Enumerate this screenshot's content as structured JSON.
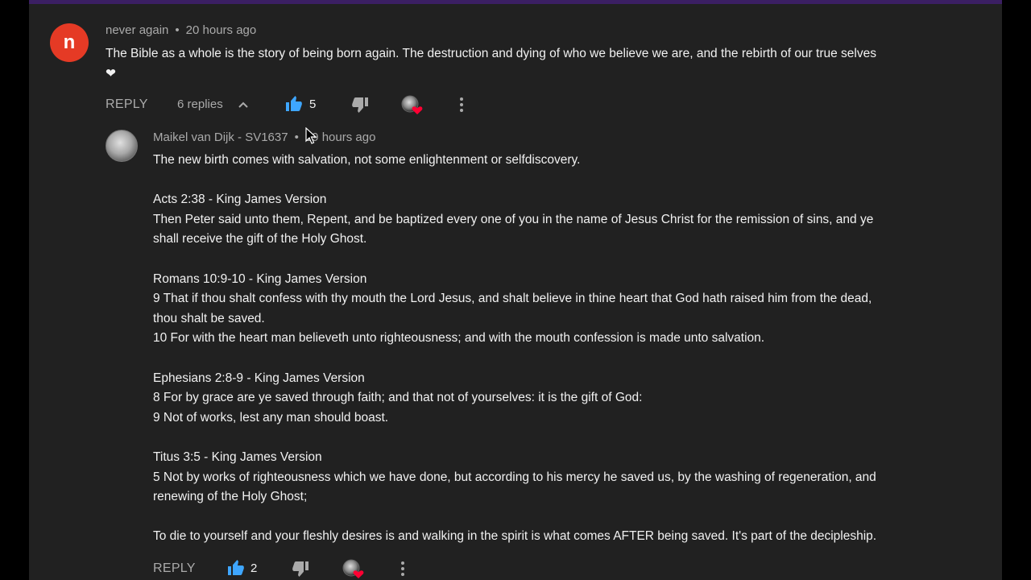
{
  "comment": {
    "avatar_letter": "n",
    "author": "never again",
    "separator": "•",
    "time": "20 hours ago",
    "text_line1": "The Bible as a whole is the story of being born again. The destruction and dying of who we believe we are, and the rebirth of our true selves",
    "text_line2": "❤",
    "reply_label": "REPLY",
    "replies_label": "6 replies",
    "likes": "5"
  },
  "reply": {
    "author": "Maikel van Dijk - SV1637",
    "separator": "•",
    "time": "19 hours ago",
    "lines": [
      "The new birth comes with salvation, not some enlightenment or selfdiscovery.",
      "",
      "Acts 2:38 - King James Version",
      "Then Peter said unto them, Repent, and be baptized every one of you in the name of Jesus Christ for the remission of sins, and ye",
      "shall receive the gift of the Holy Ghost.",
      "",
      "Romans 10:9-10 - King James Version",
      "9 That if thou shalt confess with thy mouth the Lord Jesus, and shalt believe in thine heart that God hath raised him from the dead,",
      "thou shalt be saved.",
      "10 For with the heart man believeth unto righteousness; and with the mouth confession is made unto salvation.",
      "",
      "Ephesians 2:8-9 - King James Version",
      "8 For by grace are ye saved through faith; and that not of yourselves: it is the gift of God:",
      "9 Not of works, lest any man should boast.",
      "",
      "Titus 3:5 - King James Version",
      "5 Not by works of righteousness which we have done, but according to his mercy he saved us, by the washing of regeneration, and",
      "renewing of the Holy Ghost;",
      "",
      "To die to yourself and your fleshly desires is and walking in the spirit is what comes AFTER being saved. It's part of the decipleship."
    ],
    "reply_label": "REPLY",
    "likes": "2"
  },
  "colors": {
    "background": "#212121",
    "text": "#f1f1f1",
    "secondary_text": "#aaaaaa",
    "like_active": "#3ea6ff",
    "avatar_red": "#e53a25",
    "heart_badge": "#ff0033"
  }
}
